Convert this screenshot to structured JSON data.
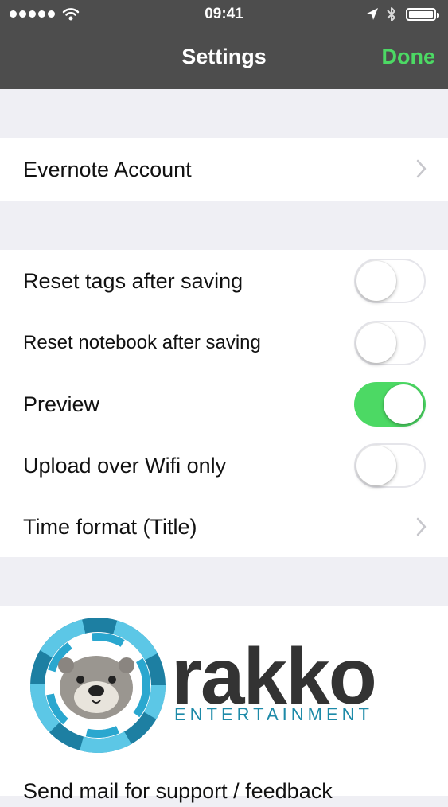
{
  "status_bar": {
    "time": "09:41"
  },
  "nav": {
    "title": "Settings",
    "done_label": "Done"
  },
  "account": {
    "label": "Evernote Account"
  },
  "settings": [
    {
      "label": "Reset tags after saving",
      "toggle": false
    },
    {
      "label": "Reset notebook after saving",
      "toggle": false
    },
    {
      "label": "Preview",
      "toggle": true
    },
    {
      "label": "Upload over Wifi only",
      "toggle": false
    },
    {
      "label": "Time format (Title)"
    }
  ],
  "logo": {
    "name": "rakko",
    "subtitle": "ENTERTAINMENT"
  },
  "support": {
    "label": "Send mail for support / feedback"
  },
  "colors": {
    "accent": "#4cd964",
    "nav_bg": "#4d4d4d",
    "logo_teal": "#1d8aa8",
    "logo_dark": "#333333"
  }
}
